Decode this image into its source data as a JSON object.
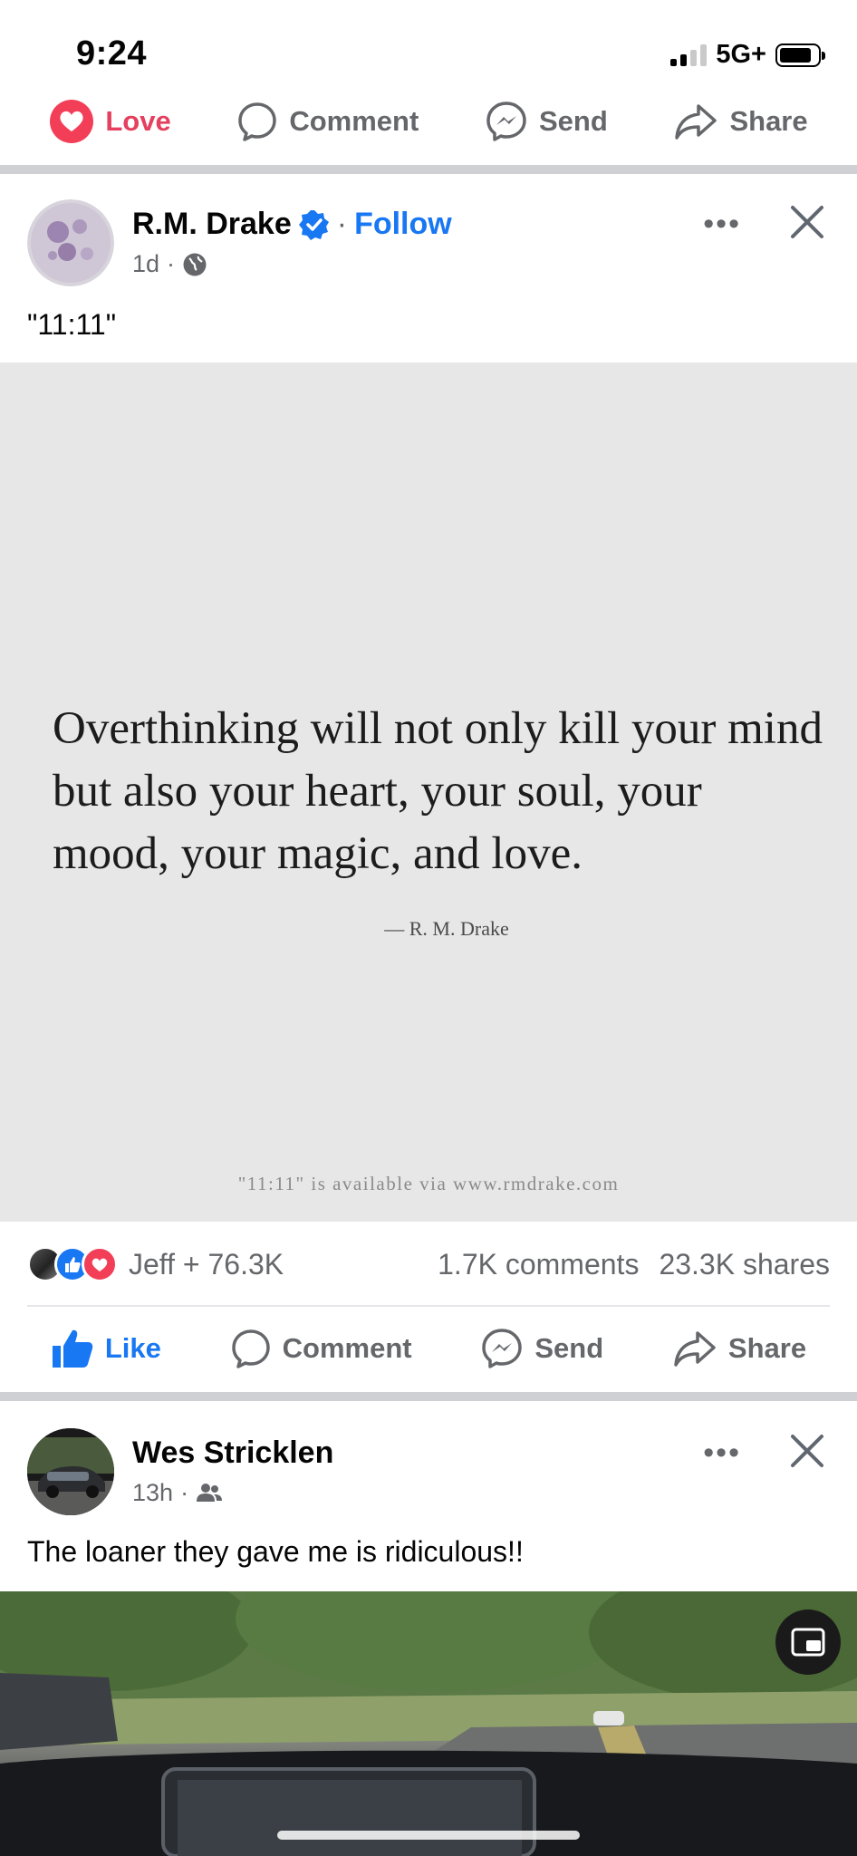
{
  "status_bar": {
    "time": "9:24",
    "network": "5G+",
    "battery_level": 0.84
  },
  "top_actions": {
    "love": "Love",
    "comment": "Comment",
    "send": "Send",
    "share": "Share"
  },
  "post1": {
    "author": "R.M. Drake",
    "follow": "Follow",
    "dot": "·",
    "time": "1d",
    "caption": "\"11:11\"",
    "quote": {
      "text": "Overthinking will not only kill your mind but also your heart, your soul, your mood, your magic, and love.",
      "attribution": "— R. M. Drake",
      "footer": "\"11:11\" is available via www.rmdrake.com"
    },
    "reactions": {
      "names": "Jeff + 76.3K",
      "comments": "1.7K comments",
      "shares": "23.3K shares"
    },
    "actions": {
      "like": "Like",
      "comment": "Comment",
      "send": "Send",
      "share": "Share"
    }
  },
  "post2": {
    "author": "Wes Stricklen",
    "dot": "·",
    "time": "13h",
    "caption": "The loaner they gave me is ridiculous!!"
  },
  "colors": {
    "brand_blue": "#1877f2",
    "love_red": "#e4405f",
    "muted_gray": "#65676b"
  },
  "icons": [
    "love-icon",
    "comment-icon",
    "send-icon",
    "share-icon",
    "verified-badge-icon",
    "globe-icon",
    "friends-icon",
    "more-icon",
    "close-icon",
    "like-icon",
    "pip-icon"
  ]
}
